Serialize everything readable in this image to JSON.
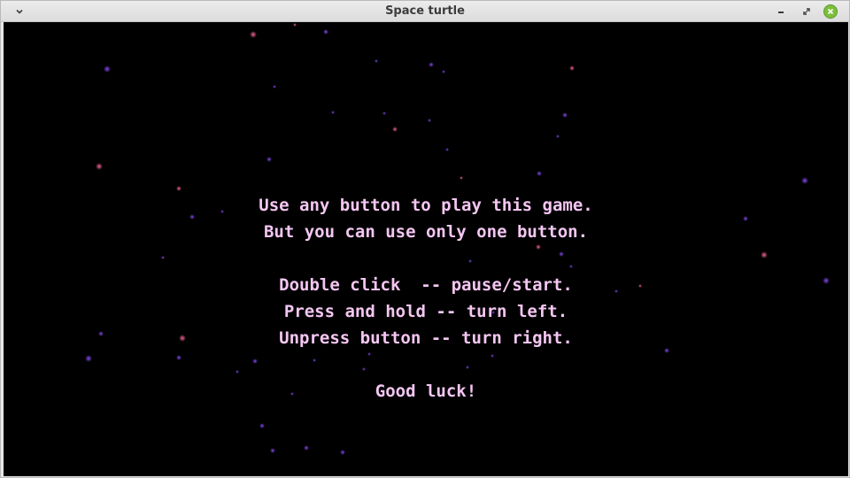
{
  "window": {
    "title": "Space turtle",
    "icons": {
      "menu": "chevron-down-icon",
      "minimize": "minimize-icon",
      "maximize": "restore-icon",
      "close": "close-icon"
    }
  },
  "colors": {
    "background": "#000000",
    "text": "#f4c6f2",
    "star_pink": "#e0407a",
    "star_purple": "#7a3adc",
    "close_button": "#7bbf3c"
  },
  "instructions": {
    "line1": "Use any button to play this game.",
    "line2": "But you can use only one button.",
    "line3": "Double click  -- pause/start.",
    "line4": "Press and hold -- turn left.",
    "line5": "Unpress button -- turn right.",
    "line6": "Good luck!"
  }
}
